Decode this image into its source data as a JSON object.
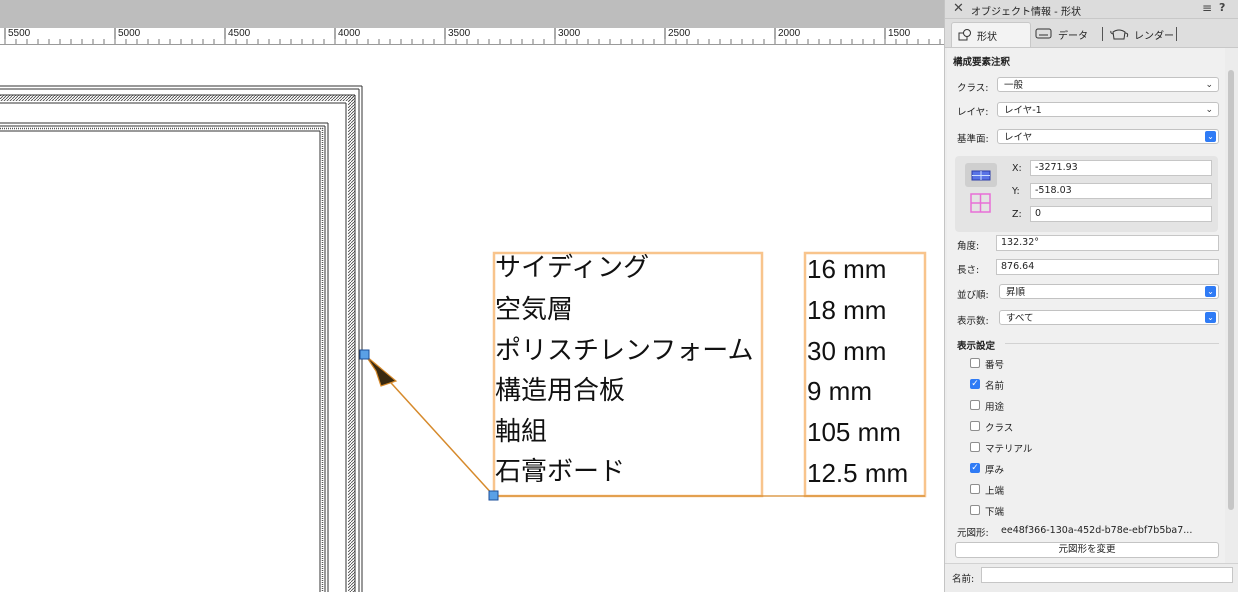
{
  "ruler": {
    "labels": [
      "5500",
      "5000",
      "4500",
      "4000",
      "3500",
      "3000",
      "2500",
      "2000",
      "1500"
    ]
  },
  "annotation": {
    "rows": [
      {
        "name": "サイディング",
        "thickness": "16 mm"
      },
      {
        "name": "空気層",
        "thickness": "18 mm"
      },
      {
        "name": "ポリスチレンフォーム",
        "thickness": "30 mm"
      },
      {
        "name": "構造用合板",
        "thickness": "9 mm"
      },
      {
        "name": "軸組",
        "thickness": "105 mm"
      },
      {
        "name": "石膏ボード",
        "thickness": "12.5 mm"
      }
    ],
    "highlight_color": "#f8c48c",
    "leader_color": "#d68a2c"
  },
  "panel": {
    "title": "オブジェクト情報 - 形状",
    "tabs": [
      {
        "label": "形状",
        "icon": "shape-icon"
      },
      {
        "label": "データ",
        "icon": "data-icon"
      },
      {
        "label": "レンダー",
        "icon": "render-teapot-icon"
      }
    ],
    "object_type": "構成要素注釈",
    "class_label": "クラス:",
    "class_value": "一般",
    "layer_label": "レイヤ:",
    "layer_value": "レイヤ-1",
    "plane_label": "基準面:",
    "plane_value": "レイヤ",
    "x_label": "X:",
    "x_value": "-3271.93",
    "y_label": "Y:",
    "y_value": "-518.03",
    "z_label": "Z:",
    "z_value": "0",
    "angle_label": "角度:",
    "angle_value": "132.32°",
    "length_label": "長さ:",
    "length_value": "876.64",
    "order_label": "並び順:",
    "order_value": "昇順",
    "count_label": "表示数:",
    "count_value": "すべて",
    "display_heading": "表示設定",
    "options": [
      {
        "label": "番号",
        "checked": false
      },
      {
        "label": "名前",
        "checked": true
      },
      {
        "label": "用途",
        "checked": false
      },
      {
        "label": "クラス",
        "checked": false
      },
      {
        "label": "マテリアル",
        "checked": false
      },
      {
        "label": "厚み",
        "checked": true
      },
      {
        "label": "上端",
        "checked": false
      },
      {
        "label": "下端",
        "checked": false
      }
    ],
    "source_label": "元図形:",
    "source_value": "ee48f366-130a-452d-b78e-ebf7b5ba7...",
    "change_source_button": "元図形を変更",
    "name_label": "名前:",
    "name_value": "",
    "accent_color": "#2f7bf5"
  }
}
